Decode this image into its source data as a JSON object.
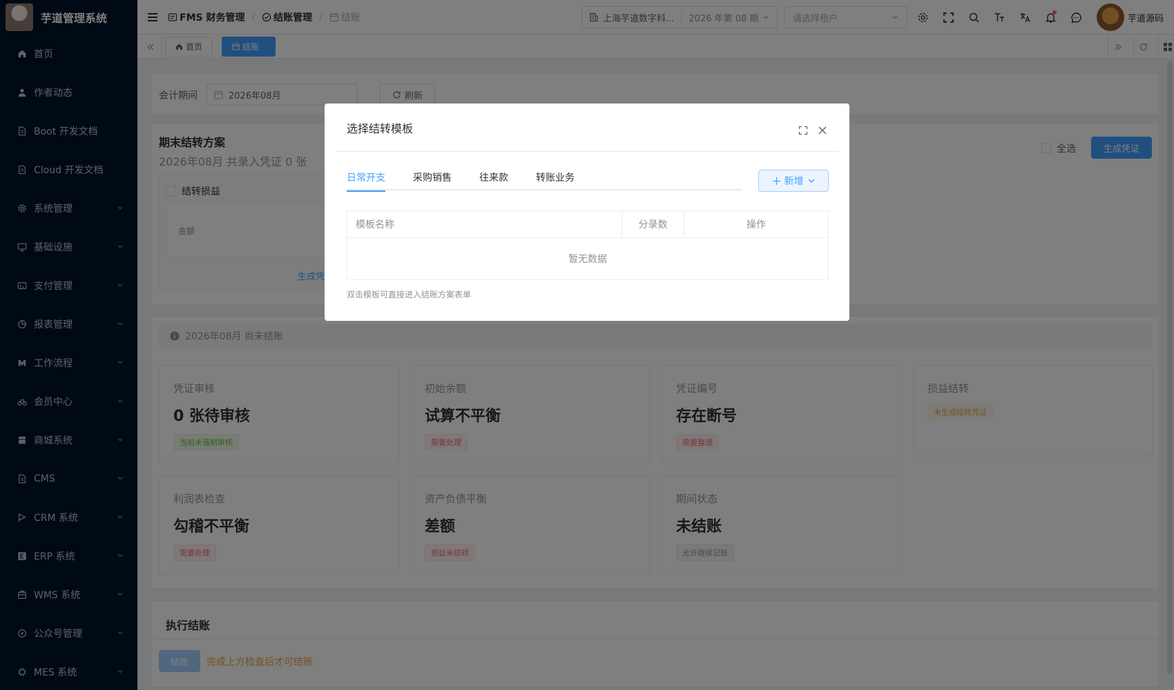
{
  "app": {
    "title": "芋道管理系统"
  },
  "sidebar": {
    "items": [
      {
        "label": "首页",
        "icon": "home-icon"
      },
      {
        "label": "作者动态",
        "icon": "user-icon"
      },
      {
        "label": "Boot 开发文档",
        "icon": "document-icon"
      },
      {
        "label": "Cloud 开发文档",
        "icon": "document-icon"
      },
      {
        "label": "系统管理",
        "icon": "gear-icon"
      },
      {
        "label": "基础设施",
        "icon": "monitor-icon"
      },
      {
        "label": "支付管理",
        "icon": "wallet-icon"
      },
      {
        "label": "报表管理",
        "icon": "pie-chart-icon"
      },
      {
        "label": "工作流程",
        "icon": "workflow-icon"
      },
      {
        "label": "会员中心",
        "icon": "bike-icon"
      },
      {
        "label": "商城系统",
        "icon": "shop-icon"
      },
      {
        "label": "CMS",
        "icon": "document-icon"
      },
      {
        "label": "CRM 系统",
        "icon": "flag-icon"
      },
      {
        "label": "ERP 系统",
        "icon": "erp-icon"
      },
      {
        "label": "WMS 系统",
        "icon": "box-icon"
      },
      {
        "label": "公众号管理",
        "icon": "compass-icon"
      },
      {
        "label": "MES 系统",
        "icon": "cpu-icon"
      }
    ]
  },
  "topbar": {
    "breadcrumbs": [
      "FMS 财务管理",
      "结账管理",
      "结账"
    ],
    "org": "上海芋道数字科...",
    "period": "2026 年第 08 期",
    "tenant_placeholder": "请选择租户",
    "user": "芋道源码"
  },
  "tags": [
    {
      "label": "首页"
    },
    {
      "label": "结账"
    }
  ],
  "filter": {
    "label": "会计期间",
    "value": "2026年08月",
    "refresh": "刷新"
  },
  "scheme": {
    "title": "期末结转方案",
    "subtitle": "2026年08月 共录入凭证 0 张",
    "select_all": "全选",
    "generate": "生成凭证",
    "item_title": "结转损益",
    "amount_label": "金额",
    "item_link": "生成凭证"
  },
  "status": {
    "alert": "2026年08月 尚未结账",
    "cards": [
      {
        "title": "凭证审核",
        "value": "0 张待审核",
        "tag": "当前未强制审核",
        "tag_type": "green"
      },
      {
        "title": "初始余额",
        "value": "试算不平衡",
        "tag": "需要处理",
        "tag_type": "red"
      },
      {
        "title": "凭证编号",
        "value": "存在断号",
        "tag": "需要整理",
        "tag_type": "red"
      },
      {
        "title": "损益结转",
        "value": "",
        "tag": "未生成结转凭证",
        "tag_type": "orange"
      },
      {
        "title": "利润表检查",
        "value": "勾稽不平衡",
        "tag": "需要处理",
        "tag_type": "red"
      },
      {
        "title": "资产负债平衡",
        "value": "差额",
        "tag": "损益未结转",
        "tag_type": "red"
      },
      {
        "title": "期间状态",
        "value": "未结账",
        "tag": "允许继续记账",
        "tag_type": "gray"
      }
    ]
  },
  "execute": {
    "title": "执行结账",
    "button": "结账",
    "hint": "完成上方检查后才可结账"
  },
  "dialog": {
    "title": "选择结转模板",
    "tabs": [
      "日常开支",
      "采购销售",
      "往来款",
      "转账业务"
    ],
    "add": "新增",
    "columns": [
      "模板名称",
      "分录数",
      "操作"
    ],
    "empty": "暂无数据",
    "hint": "双击模板可直接进入结账方案表单"
  },
  "colors": {
    "primary": "#409eff",
    "sidebar": "#001529"
  }
}
